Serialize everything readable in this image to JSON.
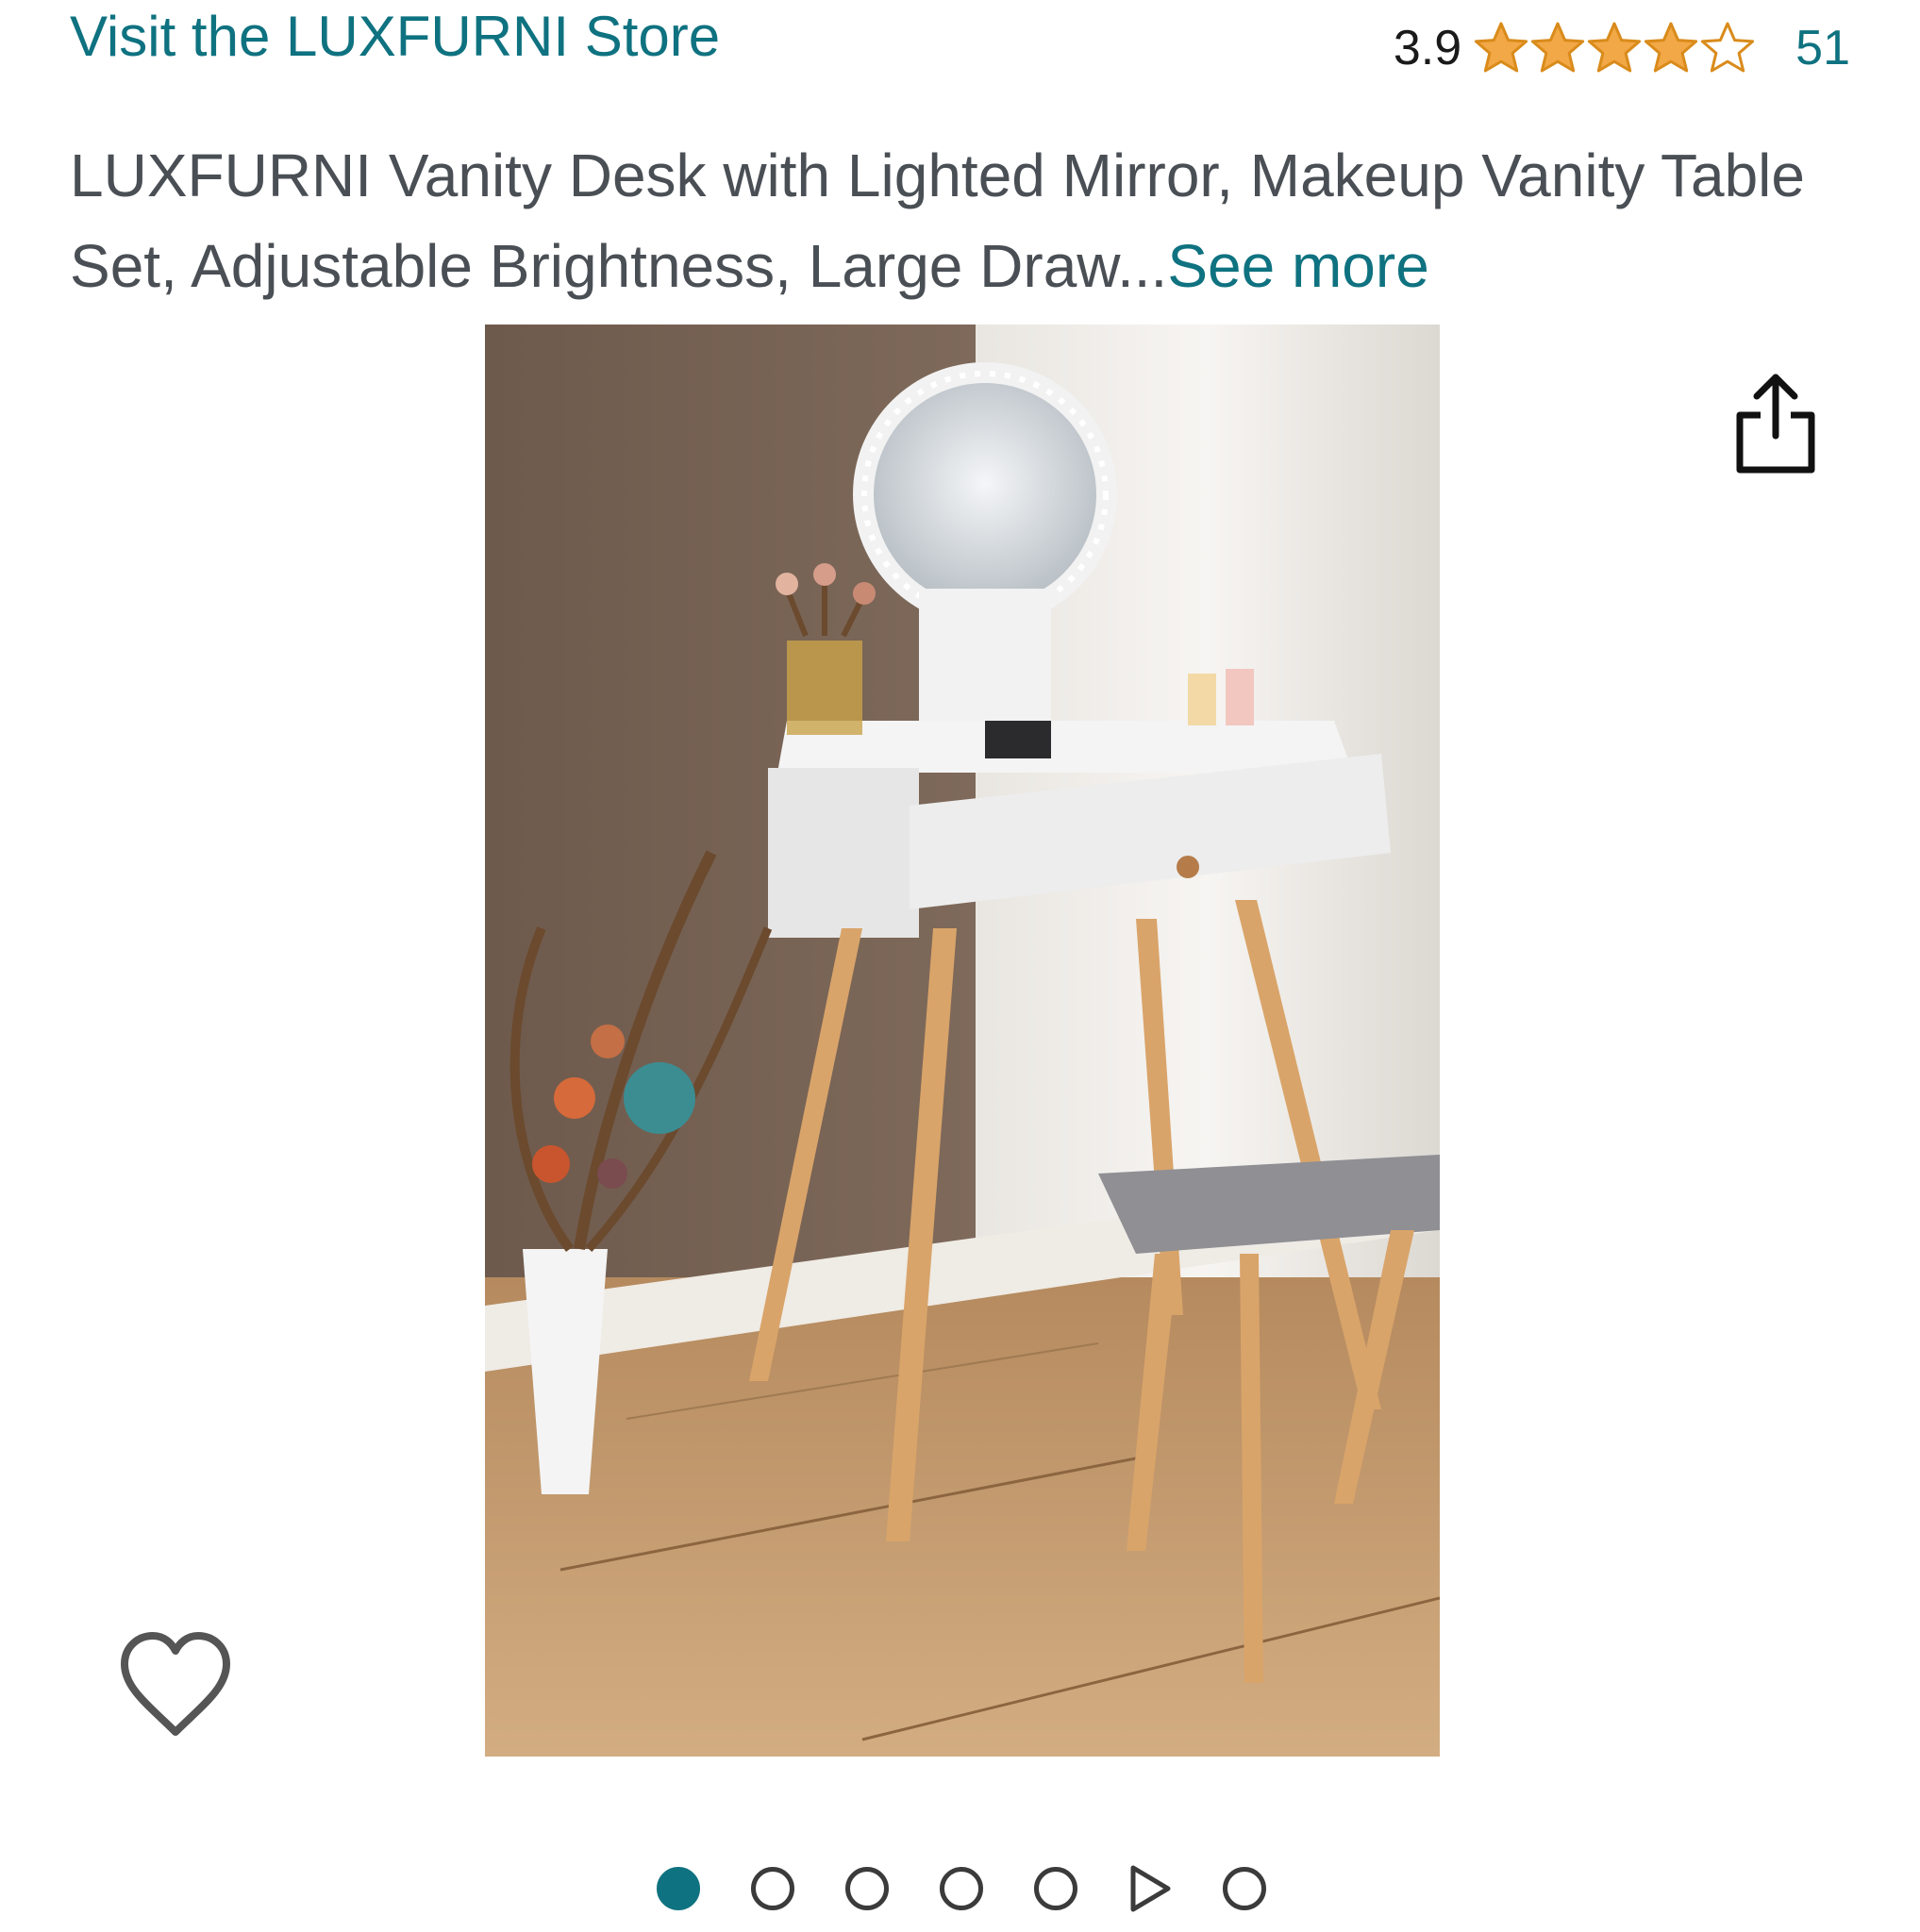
{
  "store": {
    "link_text": "Visit the LUXFURNI Store"
  },
  "rating": {
    "value": "3.9",
    "stars_filled": 3.9,
    "stars_total": 5,
    "count": "51",
    "star_color": "#f3a847"
  },
  "product": {
    "title": "LUXFURNI Vanity Desk with Lighted Mirror, Makeup Vanity Table Set, Adjustable Brightness, Large Draw...",
    "see_more": "See more"
  },
  "image_carousel": {
    "active_index": 0,
    "items": [
      "image",
      "image",
      "image",
      "image",
      "image",
      "video",
      "image"
    ],
    "accent_color": "#0f7280"
  },
  "icons": {
    "share": "share-icon",
    "wishlist": "heart-icon",
    "play": "play-icon"
  }
}
